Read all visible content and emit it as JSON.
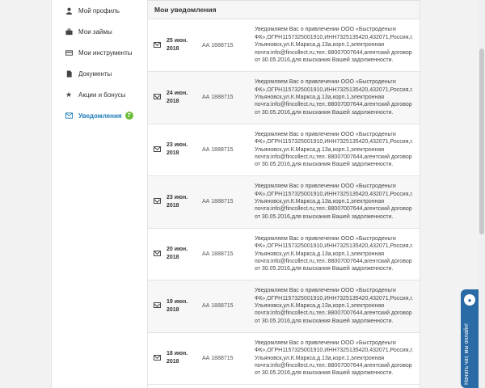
{
  "sidebar": {
    "items": [
      {
        "label": "Мой профиль",
        "icon": "user-icon"
      },
      {
        "label": "Мои займы",
        "icon": "briefcase-icon"
      },
      {
        "label": "Мои инструменты",
        "icon": "card-icon"
      },
      {
        "label": "Документы",
        "icon": "document-icon"
      },
      {
        "label": "Акции и бонусы",
        "icon": "star-icon"
      },
      {
        "label": "Уведомления",
        "icon": "envelope-icon",
        "active": true,
        "badge": "7"
      }
    ]
  },
  "main": {
    "title": "Мои уведомления",
    "rows": [
      {
        "date": "25 июн. 2018",
        "id": "АА 1888715",
        "message": "Уведомляем Вас о привлечении ООО «Быстроденьги ФК»,ОГРН1157325001910,ИНН7325135420,432071,Россия,г. Ульяновск,ул.К.Маркса,д.13а,корп.1,электронная почта:info@fincollect.ru,тел.:88007007644,агентский договор от 30.05.2016,для взыскания Вашей задолженности."
      },
      {
        "date": "24 июн. 2018",
        "id": "АА 1888715",
        "message": "Уведомляем Вас о привлечении ООО «Быстроденьги ФК»,ОГРН1157325001910,ИНН7325135420,432071,Россия,г. Ульяновск,ул.К.Маркса,д.13а,корп.1,электронная почта:info@fincollect.ru,тел.:88007007644,агентский договор от 30.05.2016,для взыскания Вашей задолженности."
      },
      {
        "date": "23 июн. 2018",
        "id": "АА 1888715",
        "message": "Уведомляем Вас о привлечении ООО «Быстроденьги ФК»,ОГРН1157325001910,ИНН7325135420,432071,Россия,г. Ульяновск,ул.К.Маркса,д.13а,корп.1,электронная почта:info@fincollect.ru,тел.:88007007644,агентский договор от 30.05.2016,для взыскания Вашей задолженности."
      },
      {
        "date": "23 июн. 2018",
        "id": "АА 1888715",
        "message": "Уведомляем Вас о привлечении ООО «Быстроденьги ФК»,ОГРН1157325001910,ИНН7325135420,432071,Россия,г. Ульяновск,ул.К.Маркса,д.13а,корп.1,электронная почта:info@fincollect.ru,тел.:88007007644,агентский договор от 30.05.2016,для взыскания Вашей задолженности."
      },
      {
        "date": "20 июн. 2018",
        "id": "АА 1888715",
        "message": "Уведомляем Вас о привлечении ООО «Быстроденьги ФК»,ОГРН1157325001910,ИНН7325135420,432071,Россия,г. Ульяновск,ул.К.Маркса,д.13а,корп.1,электронная почта:info@fincollect.ru,тел.:88007007644,агентский договор от 30.05.2016,для взыскания Вашей задолженности."
      },
      {
        "date": "19 июн. 2018",
        "id": "АА 1888715",
        "message": "Уведомляем Вас о привлечении ООО «Быстроденьги ФК»,ОГРН1157325001910,ИНН7325135420,432071,Россия,г. Ульяновск,ул.К.Маркса,д.13а,корп.1,электронная почта:info@fincollect.ru,тел.:88007007644,агентский договор от 30.05.2016,для взыскания Вашей задолженности."
      },
      {
        "date": "18 июн. 2018",
        "id": "АА 1888715",
        "message": "Уведомляем Вас о привлечении ООО «Быстроденьги ФК»,ОГРН1157325001910,ИНН7325135420,432071,Россия,г. Ульяновск,ул.К.Маркса,д.13а,корп.1,электронная почта:info@fincollect.ru,тел.:88007007644,агентский договор от 30.05.2016,для взыскания Вашей задолженности."
      }
    ]
  },
  "chat": {
    "label": "Начать чат, мы онлайн!",
    "icon": "chat-bubble-icon"
  },
  "colors": {
    "accent": "#1f7db8",
    "badge": "#6dbd3b",
    "chat": "#2a6aa5"
  }
}
